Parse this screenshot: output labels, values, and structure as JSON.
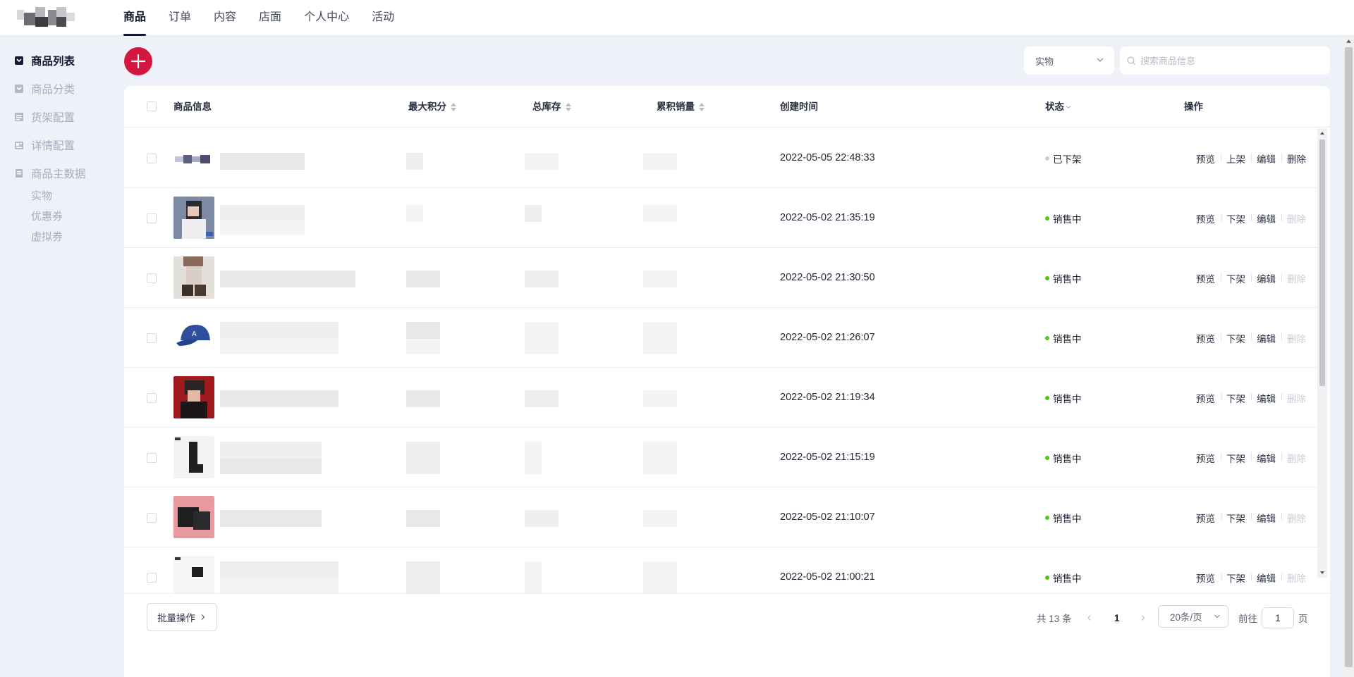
{
  "topnav": {
    "items": [
      "商品",
      "订单",
      "内容",
      "店面",
      "个人中心",
      "活动"
    ],
    "active_index": 0
  },
  "sidebar": {
    "items": [
      {
        "label": "商品列表",
        "icon": "list-icon",
        "active": true
      },
      {
        "label": "商品分类",
        "icon": "category-icon",
        "active": false
      },
      {
        "label": "货架配置",
        "icon": "shelf-icon",
        "active": false
      },
      {
        "label": "详情配置",
        "icon": "detail-icon",
        "active": false
      },
      {
        "label": "商品主数据",
        "icon": "master-data-icon",
        "active": false
      }
    ],
    "subitems": [
      "实物",
      "优惠券",
      "虚拟券"
    ]
  },
  "toolbar": {
    "add_icon": "plus-icon",
    "type_select_value": "实物",
    "search_placeholder": "搜索商品信息"
  },
  "table": {
    "columns": {
      "info": "商品信息",
      "max_points": "最大积分",
      "stock": "总库存",
      "sales": "累积销量",
      "created": "创建时间",
      "status": "状态",
      "ops": "操作"
    },
    "rows": [
      {
        "created": "2022-05-05 22:48:33",
        "status": "已下架",
        "status_color": "#c9ccd3",
        "ops": [
          "预览",
          "上架",
          "编辑",
          "删除"
        ],
        "delete_enabled": true
      },
      {
        "created": "2022-05-02 21:35:19",
        "status": "销售中",
        "status_color": "#52c41a",
        "ops": [
          "预览",
          "下架",
          "编辑",
          "删除"
        ],
        "delete_enabled": false
      },
      {
        "created": "2022-05-02 21:30:50",
        "status": "销售中",
        "status_color": "#52c41a",
        "ops": [
          "预览",
          "下架",
          "编辑",
          "删除"
        ],
        "delete_enabled": false
      },
      {
        "created": "2022-05-02 21:26:07",
        "status": "销售中",
        "status_color": "#52c41a",
        "ops": [
          "预览",
          "下架",
          "编辑",
          "删除"
        ],
        "delete_enabled": false
      },
      {
        "created": "2022-05-02 21:19:34",
        "status": "销售中",
        "status_color": "#52c41a",
        "ops": [
          "预览",
          "下架",
          "编辑",
          "删除"
        ],
        "delete_enabled": false
      },
      {
        "created": "2022-05-02 21:15:19",
        "status": "销售中",
        "status_color": "#52c41a",
        "ops": [
          "预览",
          "下架",
          "编辑",
          "删除"
        ],
        "delete_enabled": false
      },
      {
        "created": "2022-05-02 21:10:07",
        "status": "销售中",
        "status_color": "#52c41a",
        "ops": [
          "预览",
          "下架",
          "编辑",
          "删除"
        ],
        "delete_enabled": false
      },
      {
        "created": "2022-05-02 21:00:21",
        "status": "销售中",
        "status_color": "#52c41a",
        "ops": [
          "预览",
          "下架",
          "编辑",
          "删除"
        ],
        "delete_enabled": false
      }
    ]
  },
  "footer": {
    "batch_label": "批量操作",
    "total": "共 13 条",
    "current_page": "1",
    "page_size": "20条/页",
    "goto_prefix": "前往",
    "goto_value": "1",
    "goto_suffix": "页"
  },
  "colors": {
    "accent": "#d4173e",
    "nav_active": "#151a32",
    "on_sale": "#52c41a",
    "off_shelf": "#c9ccd3"
  }
}
